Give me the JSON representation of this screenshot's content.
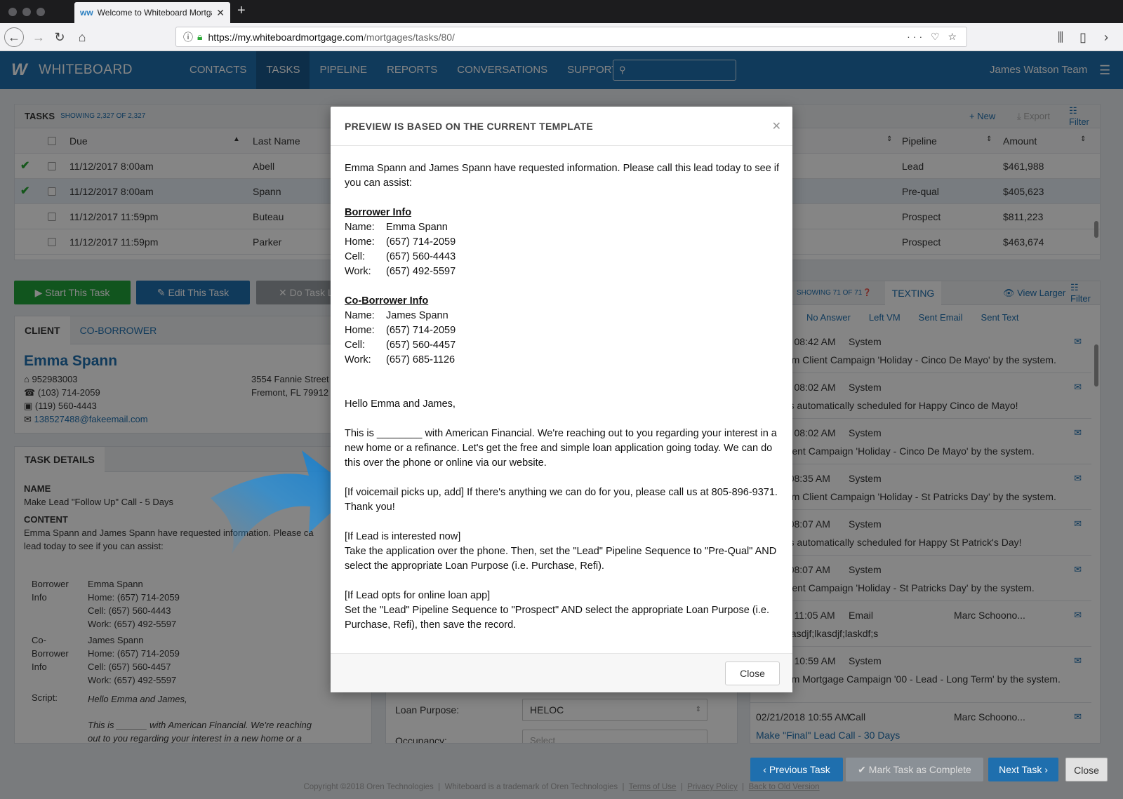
{
  "browser": {
    "tab_title": "Welcome to Whiteboard Mortga",
    "url_domain": "https://my.whiteboardmortgage.com",
    "url_path": "/mortgages/tasks/80/"
  },
  "app": {
    "brand": "WHITEBOARD",
    "nav": [
      "CONTACTS",
      "TASKS",
      "PIPELINE",
      "REPORTS",
      "CONVERSATIONS",
      "SUPPORT"
    ],
    "active_nav": "TASKS",
    "user": "James Watson Team"
  },
  "tasks": {
    "title": "TASKS",
    "showing": "SHOWING 2,327 OF 2,327",
    "new": "New",
    "export": "Export",
    "filter": "Filter",
    "col_due": "Due",
    "col_last": "Last Name",
    "col_pipeline": "Pipeline",
    "col_amount": "Amount",
    "rows": [
      {
        "due": "11/12/2017 8:00am",
        "last": "Abell",
        "pipeline": "Lead",
        "amount": "$461,988"
      },
      {
        "due": "11/12/2017 8:00am",
        "last": "Spann",
        "pipeline": "Pre-qual",
        "amount": "$405,623"
      },
      {
        "due": "11/12/2017 11:59pm",
        "last": "Buteau",
        "pipeline": "Prospect",
        "amount": "$811,223"
      },
      {
        "due": "11/12/2017 11:59pm",
        "last": "Parker",
        "pipeline": "Prospect",
        "amount": "$463,674"
      }
    ]
  },
  "actions": {
    "start": "Start This Task",
    "edit": "Edit This Task",
    "do_task": "Do Task L"
  },
  "client": {
    "tab_client": "CLIENT",
    "tab_coborrower": "CO-BORROWER",
    "name": "Emma Spann",
    "id": "952983003",
    "phone_home": "(103) 714-2059",
    "phone_work": "(119) 560-4443",
    "email": "138527488@fakeemail.com",
    "address1": "3554 Fannie Street",
    "address2": "Fremont, FL 79912"
  },
  "task_details": {
    "header": "TASK DETAILS",
    "name_label": "NAME",
    "name_value": "Make Lead \"Follow Up\" Call - 5 Days",
    "content_label": "CONTENT",
    "content_1": "Emma Spann and James Spann have requested information. Please ca",
    "content_2": "lead today to see if you can assist:",
    "borrower_label_1": "Borrower",
    "borrower_label_2": "Info",
    "borrower_lines": [
      "Emma Spann",
      "Home: (657) 714-2059",
      "Cell: (657) 560-4443",
      "Work: (657) 492-5597"
    ],
    "cob_label_1": "Co-",
    "cob_label_2": "Borrower",
    "cob_label_3": "Info",
    "cob_lines": [
      "James Spann",
      "Home: (657) 714-2059",
      "Cell: (657) 560-4457",
      "Work: (657) 492-5597"
    ],
    "script_label": "Script:",
    "script_1": "Hello Emma and James,",
    "script_2": "This is ______ with American Financial. We're reaching",
    "script_3": "out to you regarding your interest in a new home or a"
  },
  "loan": {
    "purpose_label": "Loan Purpose:",
    "purpose_value": "HELOC",
    "occupancy_label": "Occupancy:",
    "occupancy_value": "Select"
  },
  "activity": {
    "showing": "SHOWING 71 OF 71",
    "texting": "TEXTING",
    "view_larger": "View Larger",
    "filter": "Filter",
    "subtabs": [
      "No Answer",
      "Left VM",
      "Sent Email",
      "Sent Text"
    ],
    "items": [
      {
        "date": "05/2018 08:42 AM",
        "who": "System",
        "msg": "oved from Client Campaign 'Holiday - Cinco De Mayo' by the system."
      },
      {
        "date": "05/2018 08:02 AM",
        "who": "System",
        "msg": "mail was automatically scheduled for Happy Cinco de Mayo!"
      },
      {
        "date": "05/2018 08:02 AM",
        "who": "System",
        "msg": "ed to Client Campaign 'Holiday - Cinco De Mayo' by the system."
      },
      {
        "date": "6/2018 08:35 AM",
        "who": "System",
        "msg": "oved from Client Campaign 'Holiday - St Patricks Day' by the system."
      },
      {
        "date": "6/2018 08:07 AM",
        "who": "System",
        "msg": "mail was automatically scheduled for Happy St Patrick's Day!"
      },
      {
        "date": "6/2018 08:07 AM",
        "who": "System",
        "msg": "ed to Client Campaign 'Holiday - St Patricks Day' by the system."
      },
      {
        "date": "21/2018 11:05 AM",
        "who": "Email",
        "who2": "Marc Schoono...",
        "msg": "djlksdjfl;asdjf;lkasdjf;laskdf;s"
      },
      {
        "date": "21/2018 10:59 AM",
        "who": "System",
        "msg": "oved from Mortgage Campaign '00 - Lead - Long Term' by the system."
      },
      {
        "date": "02/21/2018 10:55 AM",
        "who": "Call",
        "who2": "Marc Schoono...",
        "msg": "Make \"Final\" Lead Call - 30 Days"
      }
    ]
  },
  "modal": {
    "title": "PREVIEW IS BASED ON THE CURRENT TEMPLATE",
    "intro": "Emma Spann and James Spann have requested information. Please call this lead today to see if you can assist:",
    "borrower_header": "Borrower Info",
    "borrower": [
      {
        "k": "Name:",
        "v": "Emma Spann"
      },
      {
        "k": "Home:",
        "v": "(657) 714-2059"
      },
      {
        "k": "Cell:",
        "v": "(657) 560-4443"
      },
      {
        "k": "Work:",
        "v": "(657) 492-5597"
      }
    ],
    "cob_header": "Co-Borrower Info",
    "coborrower": [
      {
        "k": "Name:",
        "v": "James Spann"
      },
      {
        "k": "Home:",
        "v": "(657) 714-2059"
      },
      {
        "k": "Cell:",
        "v": "(657) 560-4457"
      },
      {
        "k": "Work:",
        "v": "(657) 685-1126"
      }
    ],
    "greeting": "Hello Emma and James,",
    "para1": "This is ________ with American Financial. We're reaching out to you regarding your interest in a new home or a refinance. Let's get the free and simple loan application going today. We can do this over the phone or online via our website.",
    "para2": "[If voicemail picks up, add] If there's anything we can do for you, please call us at 805-896-9371. Thank you!",
    "para3a": "[If Lead is interested now]",
    "para3b": "Take the application over the phone.  Then, set the \"Lead\" Pipeline Sequence to \"Pre-Qual\" AND select the appropriate Loan Purpose (i.e. Purchase, Refi).",
    "para4a": "[If Lead opts for online loan app]",
    "para4b": "Set the \"Lead\" Pipeline Sequence to \"Prospect\" AND select the appropriate Loan Purpose (i.e. Purchase, Refi), then save the record.",
    "close": "Close"
  },
  "bottom": {
    "prev": "Previous Task",
    "mark": "Mark Task as Complete",
    "next": "Next Task",
    "close": "Close"
  },
  "footer": {
    "copyright": "Copyright ©2018 Oren Technologies",
    "trademark": "Whiteboard is a trademark of Oren Technologies",
    "terms": "Terms of Use",
    "privacy": "Privacy Policy",
    "old": "Back to Old Version"
  },
  "colors": {
    "brand": "#1f6fae",
    "green": "#21a33a",
    "overlay": "rgba(0,0,0,0.48)"
  }
}
